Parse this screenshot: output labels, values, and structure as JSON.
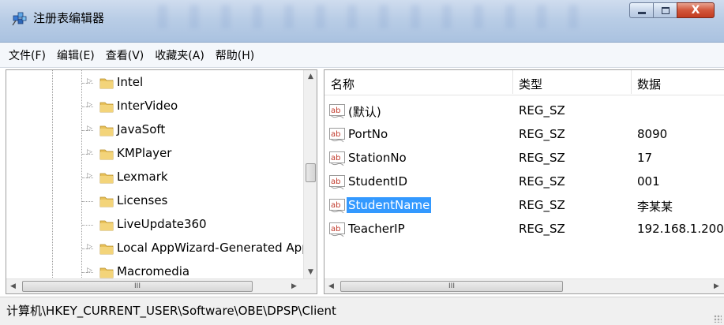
{
  "window": {
    "title": "注册表编辑器",
    "minimize_glyph": "–",
    "maximize_glyph": "□",
    "close_glyph": "X"
  },
  "menu": [
    "文件(F)",
    "编辑(E)",
    "查看(V)",
    "收藏夹(A)",
    "帮助(H)"
  ],
  "tree": {
    "items": [
      {
        "label": "Intel",
        "expandable": true
      },
      {
        "label": "InterVideo",
        "expandable": true
      },
      {
        "label": "JavaSoft",
        "expandable": true
      },
      {
        "label": "KMPlayer",
        "expandable": true
      },
      {
        "label": "Lexmark",
        "expandable": true
      },
      {
        "label": "Licenses",
        "expandable": false
      },
      {
        "label": "LiveUpdate360",
        "expandable": false
      },
      {
        "label": "Local AppWizard-Generated App",
        "expandable": true
      },
      {
        "label": "Macromedia",
        "expandable": true
      }
    ],
    "hscroll_thumb_glyph": "III"
  },
  "list": {
    "columns": {
      "name": "名称",
      "type": "类型",
      "data": "数据"
    },
    "rows": [
      {
        "name": "(默认)",
        "type": "REG_SZ",
        "data": "",
        "selected": false
      },
      {
        "name": "PortNo",
        "type": "REG_SZ",
        "data": "8090",
        "selected": false
      },
      {
        "name": "StationNo",
        "type": "REG_SZ",
        "data": "17",
        "selected": false
      },
      {
        "name": "StudentID",
        "type": "REG_SZ",
        "data": "001",
        "selected": false
      },
      {
        "name": "StudentName",
        "type": "REG_SZ",
        "data": "李某某",
        "selected": true
      },
      {
        "name": "TeacherIP",
        "type": "REG_SZ",
        "data": "192.168.1.200",
        "selected": false
      }
    ],
    "value_icon_text": "ab",
    "hscroll_thumb_glyph": "III"
  },
  "status": {
    "path": "计算机\\HKEY_CURRENT_USER\\Software\\OBE\\DPSP\\Client"
  },
  "colors": {
    "selection": "#3399ff",
    "folder": "#e8c15a",
    "value_icon_text": "#c0392b"
  }
}
